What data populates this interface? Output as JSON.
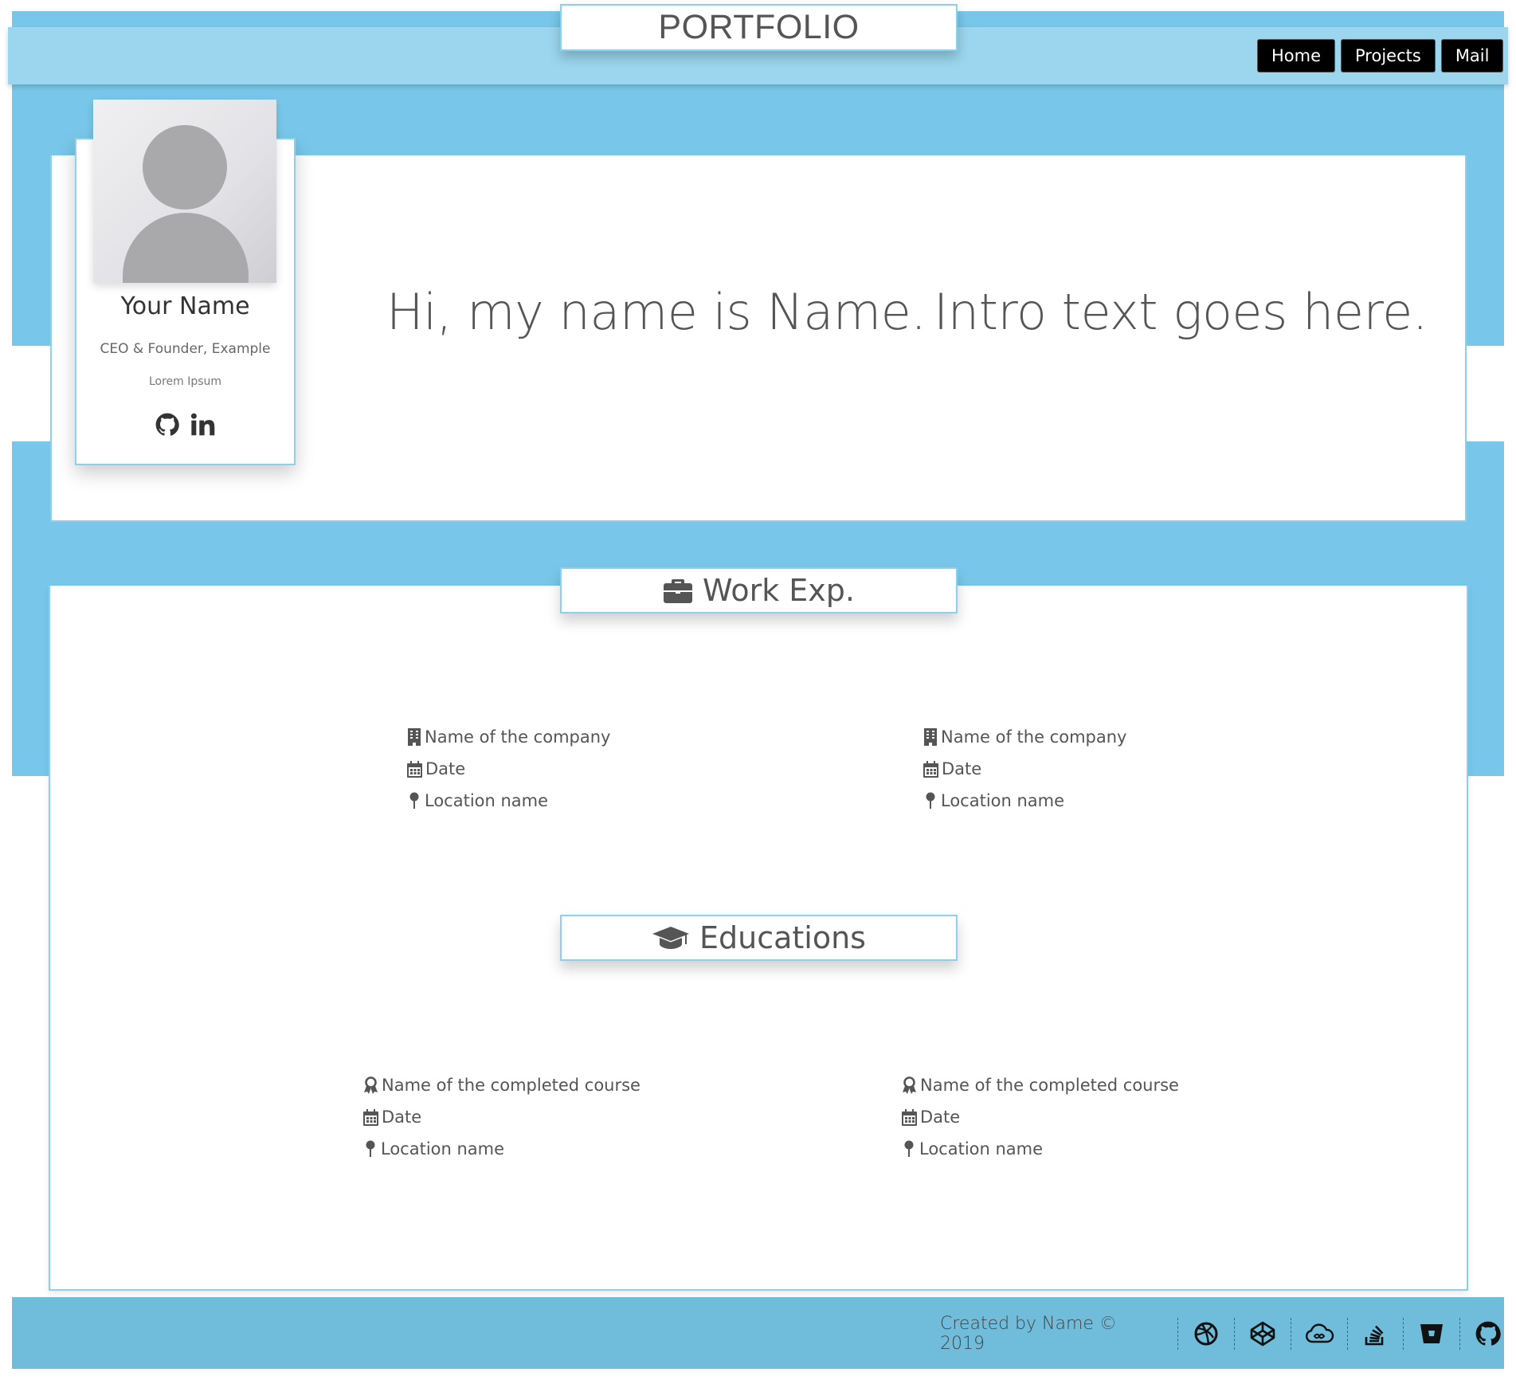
{
  "header": {
    "logo": "PORTFOLIO",
    "nav": [
      "Home",
      "Projects",
      "Mail"
    ]
  },
  "profile": {
    "name": "Your Name",
    "role": "CEO & Founder, Example",
    "tagline": "Lorem Ipsum",
    "icons": [
      "github-icon",
      "linkedin-icon"
    ]
  },
  "intro": {
    "greeting": "Hi, my name is Name.",
    "text": "Intro text goes here."
  },
  "work": {
    "title": "Work Exp.",
    "icon": "briefcase-icon",
    "entries": [
      {
        "company": "Name of the company",
        "date": "Date",
        "location": "Location name"
      },
      {
        "company": "Name of the company",
        "date": "Date",
        "location": "Location name"
      }
    ]
  },
  "education": {
    "title": "Educations",
    "icon": "graduation-cap-icon",
    "entries": [
      {
        "course": "Name of the completed course",
        "date": "Date",
        "location": "Location name"
      },
      {
        "course": "Name of the completed course",
        "date": "Date",
        "location": "Location name"
      }
    ]
  },
  "footer": {
    "text": "Created by Name © 2019",
    "icons": [
      "dribbble-icon",
      "codepen-icon",
      "cloud-icon",
      "stack-overflow-icon",
      "bitbucket-icon",
      "github-icon"
    ]
  },
  "colors": {
    "band": "#78c7ea",
    "header": "#9bd6ee",
    "footer": "#6fbcdb",
    "border": "#8ccfee",
    "nav_bg": "#000000"
  }
}
